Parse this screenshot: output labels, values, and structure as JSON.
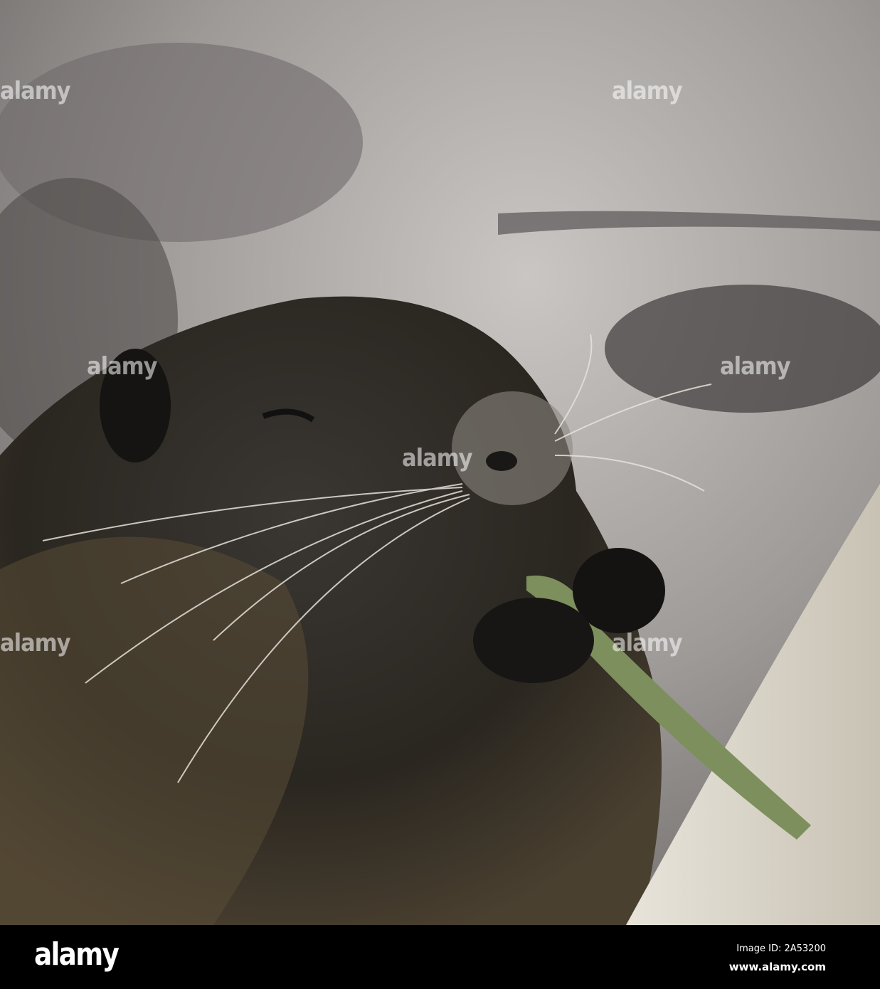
{
  "photo": {
    "subject": "nutria eating a plant stalk"
  },
  "watermark": {
    "text": "alamy"
  },
  "footer": {
    "logo": "alamy",
    "image_id": "Image ID: 2A53200",
    "website": "www.alamy.com"
  }
}
